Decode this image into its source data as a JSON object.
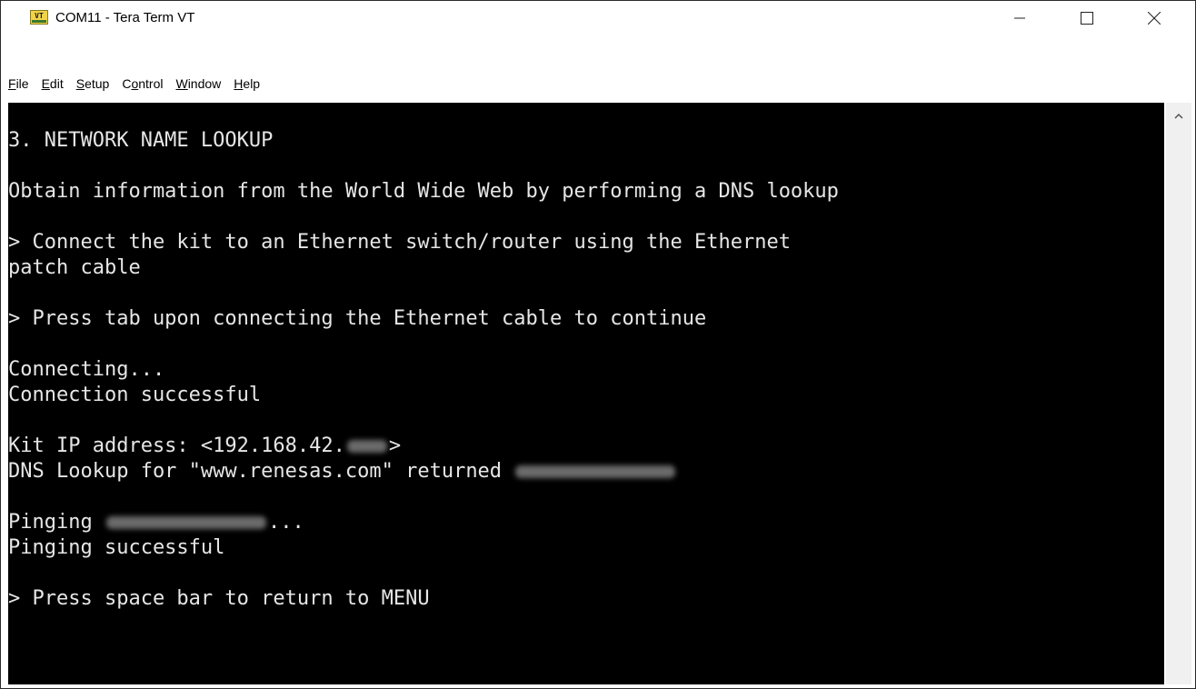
{
  "window": {
    "title": "COM11 - Tera Term VT",
    "icon": "tera-term-vt-icon",
    "icon_text": "VT",
    "controls": {
      "minimize": "minimize-icon",
      "maximize": "maximize-icon",
      "close": "close-icon"
    }
  },
  "menu": {
    "items": [
      {
        "pre": "",
        "ul": "F",
        "post": "ile"
      },
      {
        "pre": "",
        "ul": "E",
        "post": "dit"
      },
      {
        "pre": "",
        "ul": "S",
        "post": "etup"
      },
      {
        "pre": "C",
        "ul": "o",
        "post": "ntrol"
      },
      {
        "pre": "",
        "ul": "W",
        "post": "indow"
      },
      {
        "pre": "",
        "ul": "H",
        "post": "elp"
      }
    ]
  },
  "terminal": {
    "lines": [
      "3. NETWORK NAME LOOKUP",
      "Obtain information from the World Wide Web by performing a DNS lookup",
      "> Connect the kit to an Ethernet switch/router using the Ethernet",
      "patch cable",
      "> Press tab upon connecting the Ethernet cable to continue",
      "Connecting...",
      "Connection successful",
      "Kit IP address: <192.168.42.",
      ">",
      "DNS Lookup for \"www.renesas.com\" returned ",
      "Pinging ",
      "...",
      "Pinging successful",
      "> Press space bar to return to MENU"
    ],
    "colors": {
      "background": "#000000",
      "foreground": "#e6e6e6"
    }
  },
  "scrollbar": {
    "up_icon": "chevron-up-icon"
  }
}
